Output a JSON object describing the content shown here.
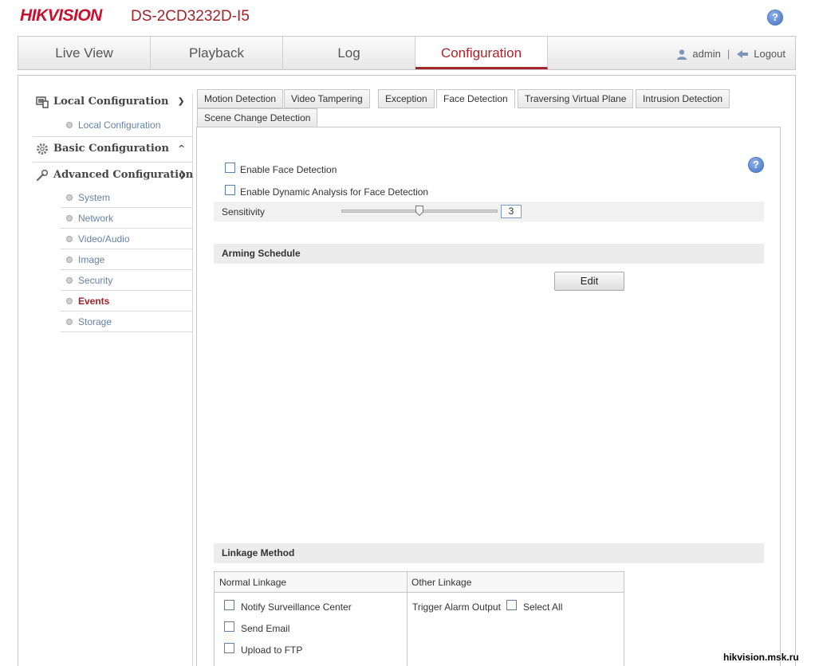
{
  "header": {
    "logo": "HIKVISION",
    "model": "DS-2CD3232D-I5",
    "help": "?"
  },
  "nav": {
    "items": [
      "Live View",
      "Playback",
      "Log",
      "Configuration"
    ],
    "active": "Configuration",
    "user": "admin",
    "separator": "|",
    "logout": "Logout"
  },
  "sidebar": {
    "local": {
      "label": "Local Configuration",
      "items": [
        "Local Configuration"
      ]
    },
    "basic": {
      "label": "Basic Configuration"
    },
    "advanced": {
      "label": "Advanced Configuration",
      "items": [
        "System",
        "Network",
        "Video/Audio",
        "Image",
        "Security",
        "Events",
        "Storage"
      ],
      "active": "Events"
    }
  },
  "tabs": {
    "items": [
      "Motion Detection",
      "Video Tampering",
      "Exception",
      "Face Detection",
      "Traversing Virtual Plane",
      "Intrusion Detection",
      "Scene Change Detection"
    ],
    "active": "Face Detection"
  },
  "face_detection": {
    "enable_label": "Enable Face Detection",
    "enable_checked": false,
    "dynamic_label": "Enable Dynamic Analysis for Face Detection",
    "dynamic_checked": false,
    "sensitivity_label": "Sensitivity",
    "sensitivity_value": "3",
    "sensitivity_fraction": 0.5,
    "help": "?"
  },
  "arming": {
    "title": "Arming Schedule",
    "edit_label": "Edit"
  },
  "linkage": {
    "title": "Linkage Method",
    "normal_header": "Normal Linkage",
    "other_header": "Other Linkage",
    "normal_items": [
      "Notify Surveillance Center",
      "Send Email",
      "Upload to FTP"
    ],
    "trigger_label": "Trigger Alarm Output",
    "select_all_label": "Select All"
  },
  "watermark": "hikvision.msk.ru",
  "colors": {
    "brand_red": "#c8102e",
    "accent": "#a5262c",
    "link_blue": "#6483a8"
  }
}
